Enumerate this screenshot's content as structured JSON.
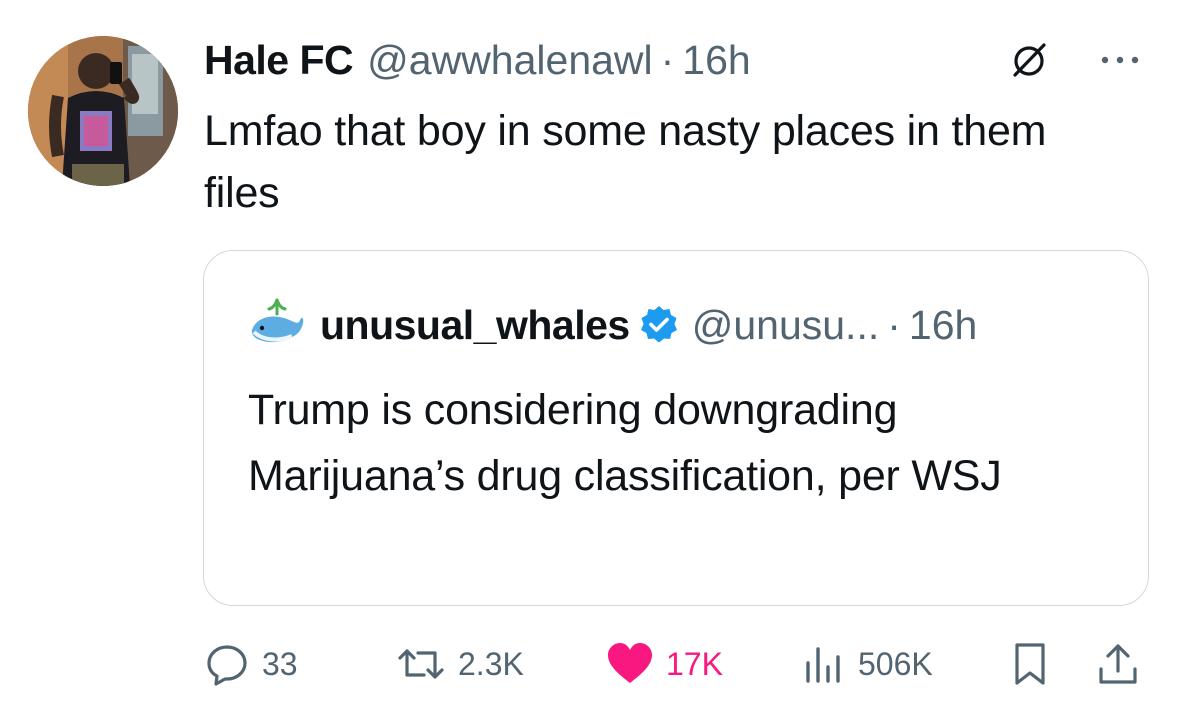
{
  "tweet": {
    "display_name": "Hale FC",
    "handle": "@awwhalenawl",
    "separator": "·",
    "time": "16h",
    "text": "Lmfao that boy in some nasty places in them files",
    "avatar_icon": "user-photo",
    "grok_icon": "grok-icon",
    "more_icon": "more-horizontal-icon"
  },
  "quote": {
    "display_name": "unusual_whales",
    "handle": "@unusu...",
    "separator": "·",
    "time": "16h",
    "text": "Trump is considering downgrading Marijuana’s drug classification, per WSJ",
    "verified": true,
    "avatar_icon": "whale-emoji-avatar"
  },
  "actions": {
    "replies": "33",
    "reposts": "2.3K",
    "likes": "17K",
    "views": "506K"
  },
  "colors": {
    "text_primary": "#0f1419",
    "text_secondary": "#536471",
    "like_pink": "#f91880",
    "verified_blue": "#1d9bf0",
    "border": "#cfd9de"
  }
}
